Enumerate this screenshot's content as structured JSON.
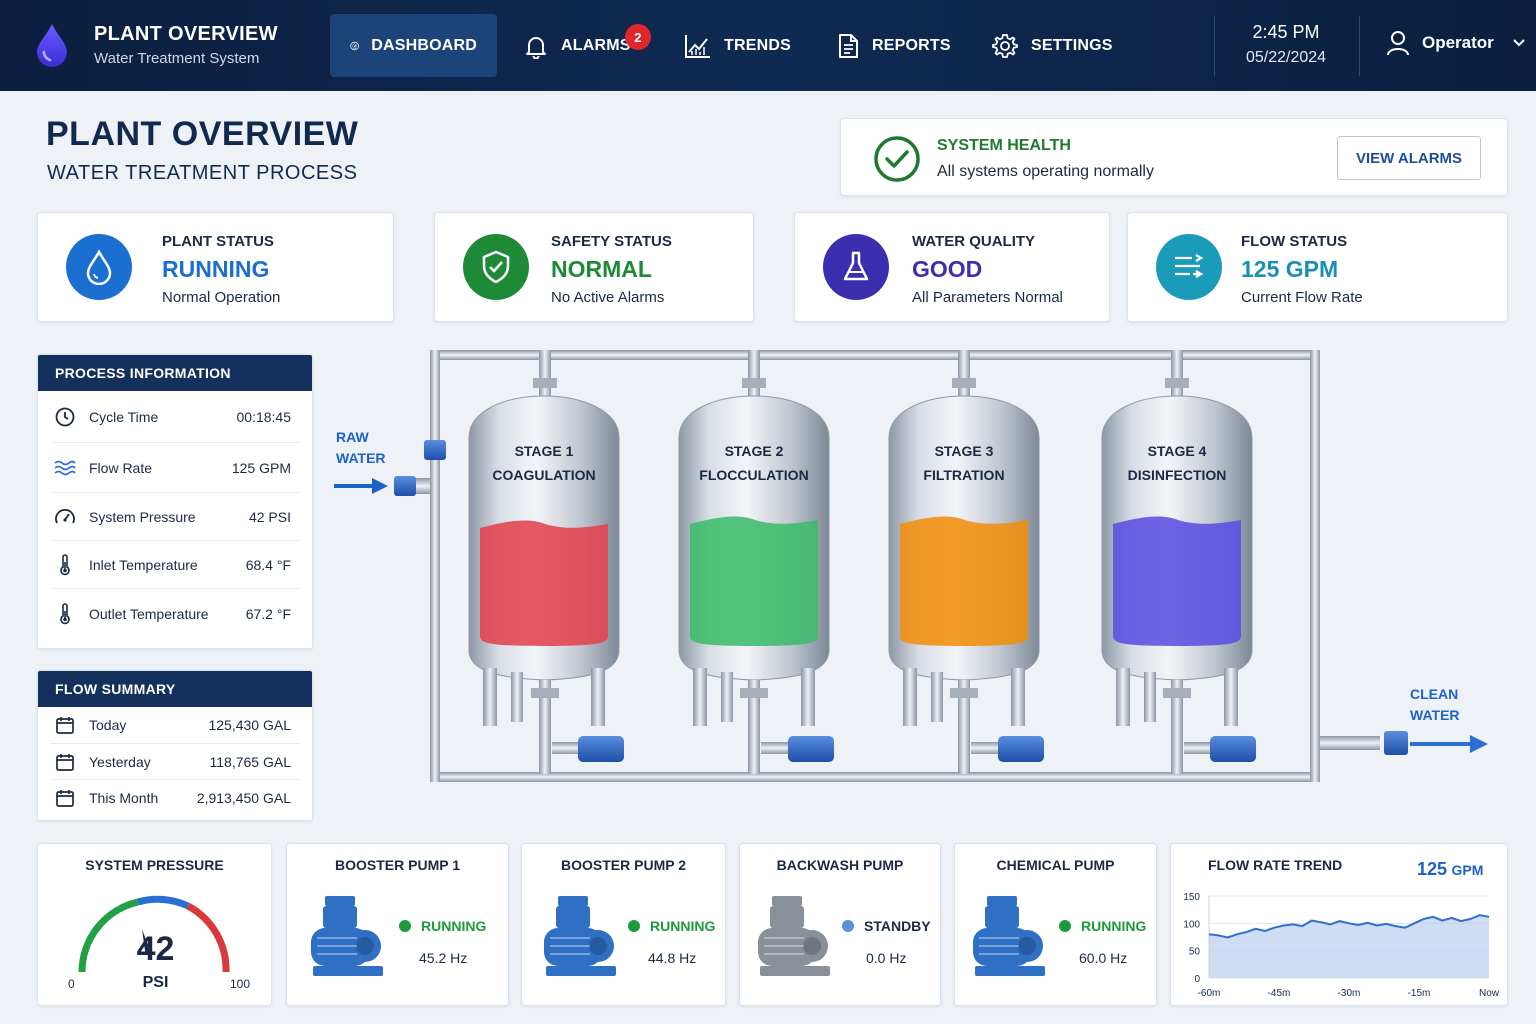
{
  "nav": {
    "brand_title": "PLANT OVERVIEW",
    "brand_subtitle": "Water Treatment System",
    "items": [
      {
        "label": "DASHBOARD",
        "icon": "dashboard-icon"
      },
      {
        "label": "ALARMS",
        "icon": "bell-icon",
        "badge": "2"
      },
      {
        "label": "TRENDS",
        "icon": "trend-chart-icon"
      },
      {
        "label": "REPORTS",
        "icon": "report-icon"
      },
      {
        "label": "SETTINGS",
        "icon": "gear-icon"
      }
    ],
    "time": "2:45 PM",
    "date": "05/22/2024",
    "user": "Operator"
  },
  "header": {
    "title": "PLANT OVERVIEW",
    "subtitle": "WATER TREATMENT PROCESS"
  },
  "health": {
    "title": "SYSTEM HEALTH",
    "message": "All systems operating normally",
    "button": "VIEW ALARMS"
  },
  "stats": [
    {
      "label": "PLANT STATUS",
      "value": "RUNNING",
      "sub": "Normal Operation",
      "color": "#1b6fd1",
      "icon": "water-drop-icon"
    },
    {
      "label": "SAFETY STATUS",
      "value": "NORMAL",
      "sub": "No Active Alarms",
      "color": "#1e8a37",
      "icon": "shield-check-icon"
    },
    {
      "label": "WATER QUALITY",
      "value": "GOOD",
      "sub": "All Parameters Normal",
      "color": "#3b2fb0",
      "icon": "flask-icon"
    },
    {
      "label": "FLOW STATUS",
      "value": "125 GPM",
      "sub": "Current Flow Rate",
      "color": "#1a8fb6",
      "icon": "flow-arrows-icon"
    }
  ],
  "process_info": {
    "title": "PROCESS INFORMATION",
    "rows": [
      {
        "label": "Cycle Time",
        "value": "00:18:45",
        "icon": "clock-icon"
      },
      {
        "label": "Flow Rate",
        "value": "125 GPM",
        "icon": "waves-icon"
      },
      {
        "label": "System Pressure",
        "value": "42 PSI",
        "icon": "gauge-icon"
      },
      {
        "label": "Inlet Temperature",
        "value": "68.4 °F",
        "icon": "thermometer-icon"
      },
      {
        "label": "Outlet Temperature",
        "value": "67.2 °F",
        "icon": "thermometer-icon"
      }
    ]
  },
  "flow_summary": {
    "title": "FLOW SUMMARY",
    "rows": [
      {
        "label": "Today",
        "value": "125,430 GAL",
        "icon": "calendar-icon"
      },
      {
        "label": "Yesterday",
        "value": "118,765 GAL",
        "icon": "calendar-icon"
      },
      {
        "label": "This Month",
        "value": "2,913,450 GAL",
        "icon": "calendar-icon"
      }
    ]
  },
  "process": {
    "inlet_label": [
      "RAW",
      "WATER"
    ],
    "outlet_label": [
      "CLEAN",
      "WATER"
    ],
    "tanks": [
      {
        "stage": "STAGE 1",
        "name": "COAGULATION",
        "color": "#e2424f"
      },
      {
        "stage": "STAGE 2",
        "name": "FLOCCULATION",
        "color": "#3cbc6b"
      },
      {
        "stage": "STAGE 3",
        "name": "FILTRATION",
        "color": "#f0900c"
      },
      {
        "stage": "STAGE 4",
        "name": "DISINFECTION",
        "color": "#5b4fe0"
      }
    ]
  },
  "pressure": {
    "title": "SYSTEM PRESSURE",
    "value": "42",
    "unit": "PSI",
    "min": "0",
    "max": "100",
    "fraction": 0.42
  },
  "pumps": [
    {
      "name": "BOOSTER PUMP 1",
      "status": "RUNNING",
      "hz": "45.2 Hz",
      "status_color": "#1e9a3c",
      "body_color": "#2f6fc4"
    },
    {
      "name": "BOOSTER PUMP 2",
      "status": "RUNNING",
      "hz": "44.8 Hz",
      "status_color": "#1e9a3c",
      "body_color": "#2f6fc4"
    },
    {
      "name": "BACKWASH PUMP",
      "status": "STANDBY",
      "hz": "0.0 Hz",
      "status_color": "#5b8fd6",
      "body_color": "#8a9099"
    },
    {
      "name": "CHEMICAL PUMP",
      "status": "RUNNING",
      "hz": "60.0 Hz",
      "status_color": "#1e9a3c",
      "body_color": "#2f6fc4"
    }
  ],
  "trend": {
    "title": "FLOW RATE TREND",
    "current": "125",
    "current_unit": "GPM"
  },
  "chart_data": {
    "type": "area",
    "title": "FLOW RATE TREND",
    "x_ticks": [
      "-60m",
      "-45m",
      "-30m",
      "-15m",
      "Now"
    ],
    "y_ticks": [
      "150",
      "100",
      "50",
      "0"
    ],
    "ylim": [
      0,
      150
    ],
    "xlim": [
      -60,
      0
    ],
    "x": [
      -60,
      -58,
      -56,
      -54,
      -52,
      -50,
      -48,
      -46,
      -44,
      -42,
      -40,
      -38,
      -36,
      -34,
      -32,
      -30,
      -28,
      -26,
      -24,
      -22,
      -20,
      -18,
      -16,
      -14,
      -12,
      -10,
      -8,
      -6,
      -4,
      -2,
      0
    ],
    "values": [
      80,
      78,
      74,
      80,
      84,
      90,
      86,
      92,
      96,
      98,
      95,
      105,
      102,
      98,
      104,
      100,
      97,
      101,
      96,
      99,
      95,
      92,
      100,
      108,
      112,
      105,
      110,
      104,
      108,
      115,
      112
    ],
    "color": "#2e6fd1"
  }
}
